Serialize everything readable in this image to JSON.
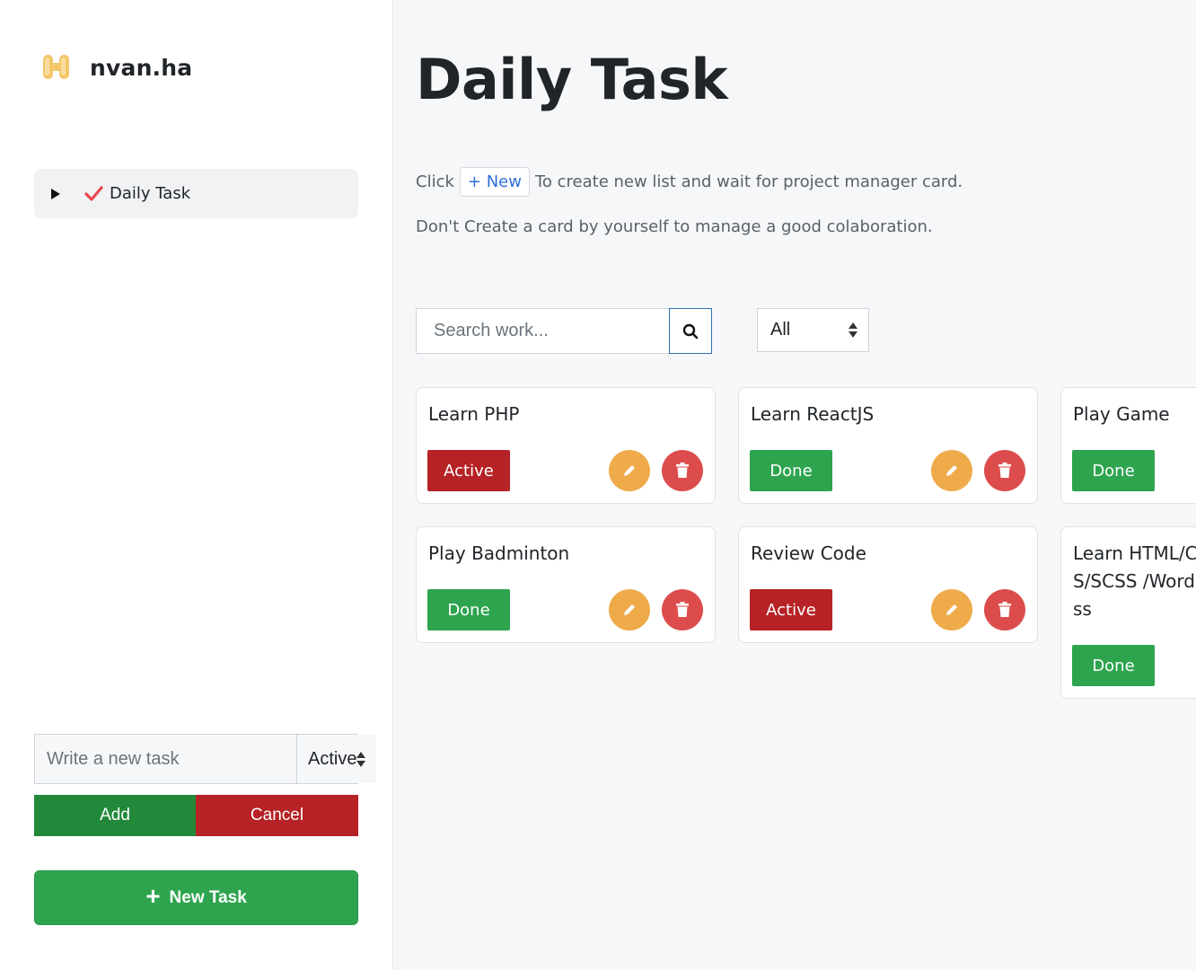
{
  "sidebar": {
    "brand_name": "nvan.ha",
    "nav_item_label": "Daily Task",
    "new_task_placeholder": "Write a new task",
    "new_task_status": "Active",
    "add_label": "Add",
    "cancel_label": "Cancel",
    "new_task_button_label": "New Task"
  },
  "main": {
    "title": "Daily Task",
    "desc_click": "Click",
    "desc_new_chip": "+ New",
    "desc_line1_rest": "To create new list and wait for project manager card.",
    "desc_line2": "Don't Create a card by yourself to manage a good colaboration.",
    "search_placeholder": "Search work...",
    "filter_value": "All"
  },
  "cards": [
    {
      "title": "Learn PHP",
      "status": "Active"
    },
    {
      "title": "Learn ReactJS",
      "status": "Done"
    },
    {
      "title": "Play Game",
      "status": "Done"
    },
    {
      "title": "Play Badminton",
      "status": "Done"
    },
    {
      "title": "Review Code",
      "status": "Active"
    },
    {
      "title": "Learn HTML/CSS/SCSS /WordPress",
      "status": "Done"
    }
  ],
  "icons": {
    "brand": "logo-icon",
    "nav_caret": "caret-right-icon",
    "nav_check": "checkmark-icon",
    "select_arrows": "sort-arrows-icon",
    "plus": "plus-icon",
    "search": "search-icon",
    "edit": "pencil-icon",
    "delete": "trash-icon"
  },
  "colors": {
    "active": "#b62225",
    "done": "#2ea44f",
    "edit": "#efaa4a",
    "delete": "#dc4c4c",
    "add": "#23893a",
    "new_task": "#2ea44f"
  }
}
